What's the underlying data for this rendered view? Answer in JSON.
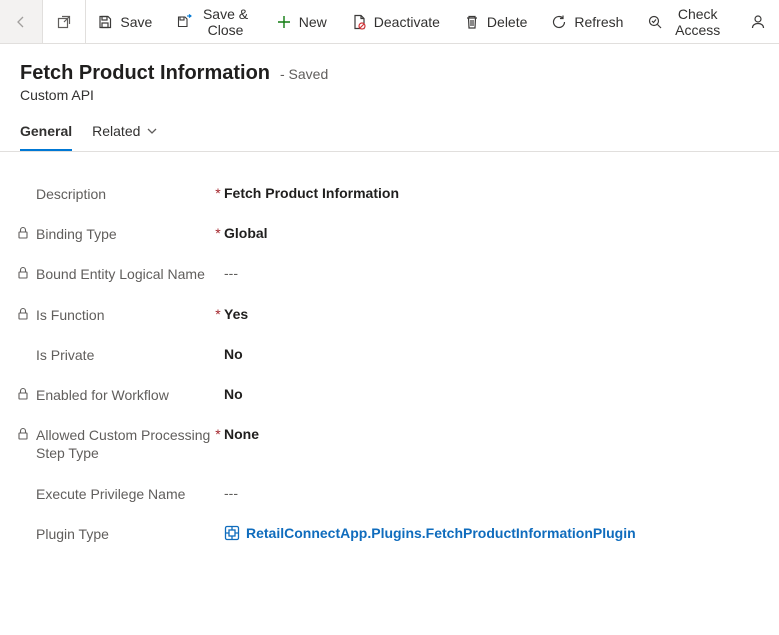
{
  "toolbar": {
    "save": "Save",
    "saveClose": "Save & Close",
    "new": "New",
    "deactivate": "Deactivate",
    "delete": "Delete",
    "refresh": "Refresh",
    "checkAccess": "Check Access"
  },
  "header": {
    "title": "Fetch Product Information",
    "savedBadge": "- Saved",
    "entityType": "Custom API"
  },
  "tabs": {
    "general": "General",
    "related": "Related"
  },
  "form": {
    "description": {
      "label": "Description",
      "value": "Fetch Product Information",
      "required": true,
      "locked": false
    },
    "bindingType": {
      "label": "Binding Type",
      "value": "Global",
      "required": true,
      "locked": true
    },
    "boundEntity": {
      "label": "Bound Entity Logical Name",
      "value": "---",
      "required": false,
      "locked": true
    },
    "isFunction": {
      "label": "Is Function",
      "value": "Yes",
      "required": true,
      "locked": true
    },
    "isPrivate": {
      "label": "Is Private",
      "value": "No",
      "required": false,
      "locked": false
    },
    "enabledWorkflow": {
      "label": "Enabled for Workflow",
      "value": "No",
      "required": false,
      "locked": true
    },
    "allowedStep": {
      "label": "Allowed Custom Processing Step Type",
      "value": "None",
      "required": true,
      "locked": true
    },
    "execPrivilege": {
      "label": "Execute Privilege Name",
      "value": "---",
      "required": false,
      "locked": false
    },
    "pluginType": {
      "label": "Plugin Type",
      "value": "RetailConnectApp.Plugins.FetchProductInformationPlugin",
      "required": false,
      "locked": false
    }
  }
}
